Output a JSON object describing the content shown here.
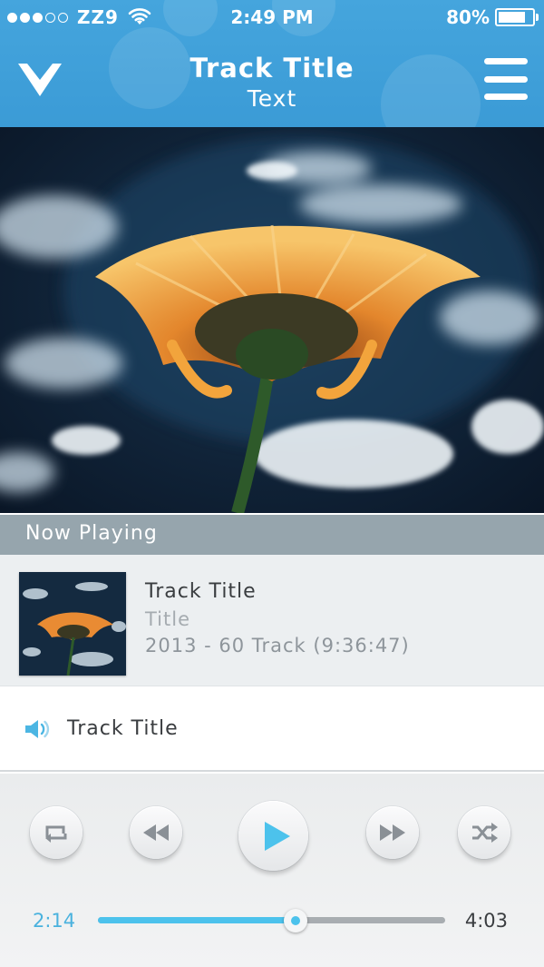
{
  "status_bar": {
    "signal_bars_filled": 3,
    "signal_bars_total": 5,
    "carrier": "ZZ9",
    "time": "2:49 PM",
    "battery": "80%",
    "battery_level": 0.8
  },
  "header": {
    "title": "Track Title",
    "subtitle": "Text",
    "collapse_icon": "chevron-down-icon",
    "menu_icon": "hamburger-menu-icon"
  },
  "now_playing": {
    "section_label": "Now Playing",
    "track_title": "Track Title",
    "album": "Title",
    "meta": "2013 - 60 Track (9:36:47)"
  },
  "current_track": {
    "icon": "speaker-icon",
    "label": "Track Title"
  },
  "controls": {
    "repeat_icon": "repeat-icon",
    "rewind_icon": "rewind-icon",
    "play_icon": "play-icon",
    "forward_icon": "fast-forward-icon",
    "shuffle_icon": "shuffle-icon"
  },
  "progress": {
    "elapsed": "2:14",
    "total": "4:03",
    "fraction": 0.57
  },
  "colors": {
    "header_blue": "#3b9bd6",
    "accent": "#4cc2ec",
    "section_bar": "#96a5ad"
  }
}
